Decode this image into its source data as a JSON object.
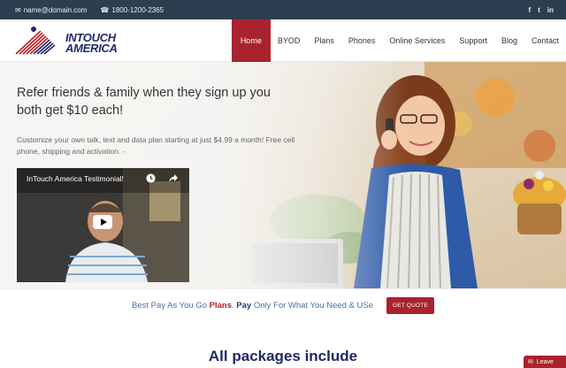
{
  "topbar": {
    "email": "name@domain.com",
    "phone": "1800-1200-2365",
    "social": [
      "f",
      "t",
      "in"
    ]
  },
  "logo": {
    "line1": "InTouch",
    "line2": "America"
  },
  "nav": {
    "items": [
      "Home",
      "BYOD",
      "Plans",
      "Phones",
      "Online Services",
      "Support",
      "Blog",
      "Contact"
    ],
    "active": "Home"
  },
  "hero": {
    "headline": "Refer friends & family when they sign up you both get $10 each!",
    "subtext": "Customize your own talk, text and data plan starting at just $4.99 a month! Free cell phone, shipping and activation. -"
  },
  "video": {
    "title": "InTouch America Testimonial!"
  },
  "quote_strip": {
    "part1": "Best Pay As You Go ",
    "part2": "Plans",
    "part3": ". ",
    "part4": "Pay",
    "part5": " Only For What You Need & USe",
    "button": "GET QUOTE"
  },
  "section": {
    "title": "All packages include"
  },
  "leave_button": {
    "label": "Leave"
  },
  "colors": {
    "topbar": "#2c3e50",
    "accent": "#a8232e",
    "navy": "#1f2a6b"
  }
}
